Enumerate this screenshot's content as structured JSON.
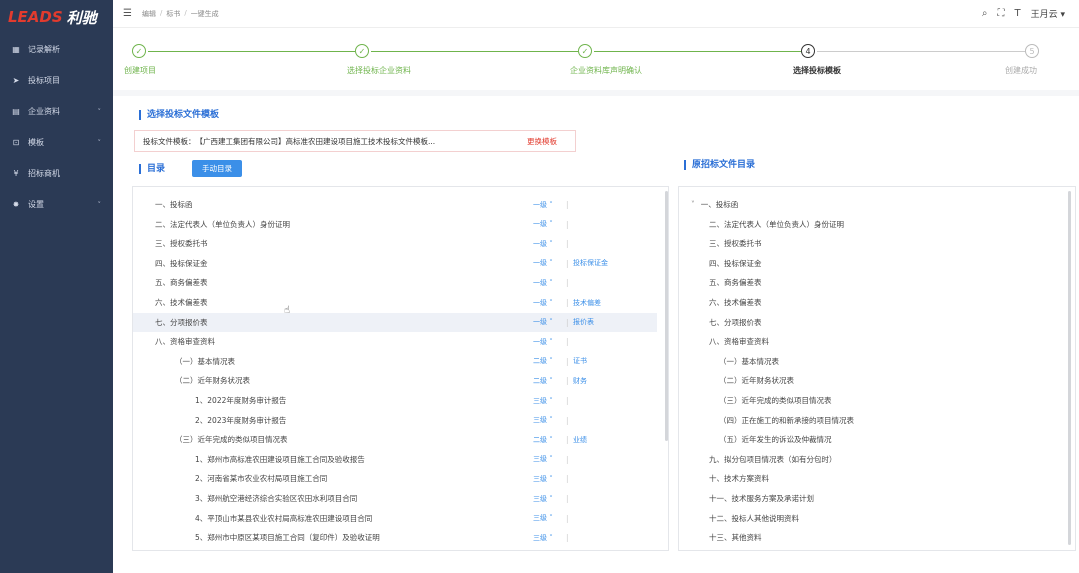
{
  "logo": {
    "brand_en": "LEADS",
    "brand_cn": "利驰"
  },
  "sidebar": {
    "items": [
      {
        "icon": "grid-icon",
        "glyph": "▦",
        "label": "记录解析",
        "has_children": false
      },
      {
        "icon": "send-icon",
        "glyph": "➤",
        "label": "投标项目",
        "has_children": false
      },
      {
        "icon": "doc-icon",
        "glyph": "▤",
        "label": "企业资料",
        "has_children": true
      },
      {
        "icon": "chart-icon",
        "glyph": "⊡",
        "label": "模板",
        "has_children": true
      },
      {
        "icon": "yen-icon",
        "glyph": "¥",
        "label": "招标商机",
        "has_children": false
      },
      {
        "icon": "gear-icon",
        "glyph": "✸",
        "label": "设置",
        "has_children": true
      }
    ]
  },
  "header": {
    "breadcrumb": [
      "编辑",
      "标书",
      "一键生成"
    ],
    "user": "王月云"
  },
  "steps": [
    {
      "num": "✓",
      "label": "创建项目",
      "state": "done"
    },
    {
      "num": "✓",
      "label": "选择投标企业资料",
      "state": "done"
    },
    {
      "num": "✓",
      "label": "企业资料库声明确认",
      "state": "done"
    },
    {
      "num": "4",
      "label": "选择投标模板",
      "state": "active"
    },
    {
      "num": "5",
      "label": "创建成功",
      "state": "todo"
    }
  ],
  "template": {
    "section_title": "选择投标文件模板",
    "prefix": "投标文件模板：",
    "name": "【广西建工集团有限公司】高标准农田建设项目施工技术投标文件模板...",
    "change_label": "更换模板"
  },
  "directory": {
    "section_title": "目录",
    "manual_button": "手动目录",
    "rows": [
      {
        "text": "一、投标函",
        "indent": 0,
        "level": "一级 ˅",
        "tag": ""
      },
      {
        "text": "二、法定代表人（单位负责人）身份证明",
        "indent": 0,
        "level": "一级 ˅",
        "tag": ""
      },
      {
        "text": "三、授权委托书",
        "indent": 0,
        "level": "一级 ˅",
        "tag": ""
      },
      {
        "text": "四、投标保证金",
        "indent": 0,
        "level": "一级 ˅",
        "tag": "投标保证金"
      },
      {
        "text": "五、商务偏差表",
        "indent": 0,
        "level": "一级 ˅",
        "tag": ""
      },
      {
        "text": "六、技术偏差表",
        "indent": 0,
        "level": "一级 ˅",
        "tag": "技术偏差"
      },
      {
        "text": "七、分项报价表",
        "indent": 0,
        "level": "一级 ˅",
        "tag": "报价表"
      },
      {
        "text": "八、资格审查资料",
        "indent": 0,
        "level": "一级 ˅",
        "tag": ""
      },
      {
        "text": "（一）基本情况表",
        "indent": 1,
        "level": "二级 ˅",
        "tag": "证书"
      },
      {
        "text": "（二）近年财务状况表",
        "indent": 1,
        "level": "二级 ˅",
        "tag": "财务"
      },
      {
        "text": "1、2022年度财务审计报告",
        "indent": 2,
        "level": "三级 ˅",
        "tag": ""
      },
      {
        "text": "2、2023年度财务审计报告",
        "indent": 2,
        "level": "三级 ˅",
        "tag": ""
      },
      {
        "text": "（三）近年完成的类似项目情况表",
        "indent": 1,
        "level": "二级 ˅",
        "tag": "业绩"
      },
      {
        "text": "1、郑州市高标准农田建设项目施工合同及验收报告",
        "indent": 2,
        "level": "三级 ˅",
        "tag": ""
      },
      {
        "text": "2、河南省某市农业农村局项目施工合同",
        "indent": 2,
        "level": "三级 ˅",
        "tag": ""
      },
      {
        "text": "3、郑州航空港经济综合实验区农田水利项目合同",
        "indent": 2,
        "level": "三级 ˅",
        "tag": ""
      },
      {
        "text": "4、平顶山市某县农业农村局高标准农田建设项目合同",
        "indent": 2,
        "level": "三级 ˅",
        "tag": ""
      },
      {
        "text": "5、郑州市中原区某项目施工合同（复印件）及验收证明",
        "indent": 2,
        "level": "三级 ˅",
        "tag": ""
      }
    ]
  },
  "original": {
    "section_title": "原招标文件目录",
    "rows": [
      {
        "text": "一、投标函",
        "indent": 0,
        "caret": "˅"
      },
      {
        "text": "二、法定代表人（单位负责人）身份证明",
        "indent": 1,
        "caret": ""
      },
      {
        "text": "三、授权委托书",
        "indent": 1,
        "caret": ""
      },
      {
        "text": "四、投标保证金",
        "indent": 1,
        "caret": ""
      },
      {
        "text": "五、商务偏差表",
        "indent": 1,
        "caret": ""
      },
      {
        "text": "六、技术偏差表",
        "indent": 1,
        "caret": ""
      },
      {
        "text": "七、分项报价表",
        "indent": 1,
        "caret": ""
      },
      {
        "text": "八、资格审查资料",
        "indent": 1,
        "caret": ""
      },
      {
        "text": "（一）基本情况表",
        "indent": 2,
        "caret": ""
      },
      {
        "text": "（二）近年财务状况表",
        "indent": 2,
        "caret": ""
      },
      {
        "text": "（三）近年完成的类似项目情况表",
        "indent": 2,
        "caret": ""
      },
      {
        "text": "（四）正在施工的和新承接的项目情况表",
        "indent": 2,
        "caret": ""
      },
      {
        "text": "（五）近年发生的诉讼及仲裁情况",
        "indent": 2,
        "caret": ""
      },
      {
        "text": "九、拟分包项目情况表（如有分包时）",
        "indent": 1,
        "caret": ""
      },
      {
        "text": "十、技术方案资料",
        "indent": 1,
        "caret": ""
      },
      {
        "text": "十一、技术服务方案及承诺计划",
        "indent": 1,
        "caret": ""
      },
      {
        "text": "十二、投标人其他说明资料",
        "indent": 1,
        "caret": ""
      },
      {
        "text": "十三、其他资料",
        "indent": 1,
        "caret": ""
      }
    ]
  }
}
